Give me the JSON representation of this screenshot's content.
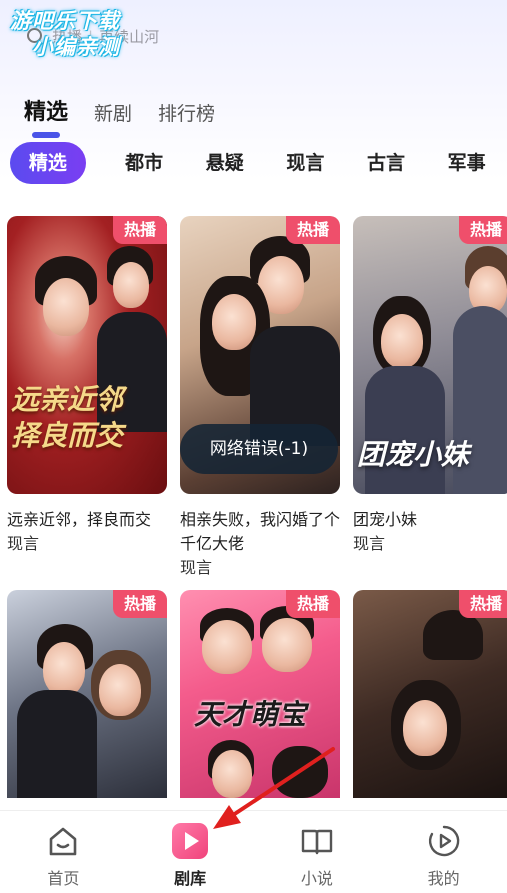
{
  "watermark": {
    "line1": "游吧乐下载",
    "line2": "小编亲测"
  },
  "search": {
    "hint_left": "热播",
    "hint_right": "再续山河"
  },
  "main_tabs": [
    {
      "label": "精选",
      "active": true
    },
    {
      "label": "新剧",
      "active": false
    },
    {
      "label": "排行榜",
      "active": false
    }
  ],
  "categories": [
    {
      "label": "精选",
      "active": true
    },
    {
      "label": "都市",
      "active": false
    },
    {
      "label": "悬疑",
      "active": false
    },
    {
      "label": "现言",
      "active": false
    },
    {
      "label": "古言",
      "active": false
    },
    {
      "label": "军事",
      "active": false
    }
  ],
  "badge_text": "热播",
  "cards": [
    {
      "title": "远亲近邻，择良而交",
      "tag": "现言",
      "poster_text": "远亲近邻\n择良而交"
    },
    {
      "title": "相亲失败，我闪婚了个千亿大佬",
      "tag": "现言",
      "poster_text": ""
    },
    {
      "title": "团宠小妹",
      "tag": "现言",
      "poster_text": "团宠小妹"
    },
    {
      "title": "",
      "tag": "",
      "poster_text": ""
    },
    {
      "title": "",
      "tag": "",
      "poster_text": "天才萌宝"
    },
    {
      "title": "",
      "tag": "",
      "poster_text": ""
    }
  ],
  "toast": "网络错误(-1)",
  "bottom_nav": [
    {
      "label": "首页",
      "icon": "home-icon",
      "active": false
    },
    {
      "label": "剧库",
      "icon": "play-icon",
      "active": true
    },
    {
      "label": "小说",
      "icon": "book-icon",
      "active": false
    },
    {
      "label": "我的",
      "icon": "mine-icon",
      "active": false
    }
  ],
  "colors": {
    "accent": "#5b4bf0",
    "badge": "#ef4f6b",
    "annotation_arrow": "#e0201e"
  }
}
